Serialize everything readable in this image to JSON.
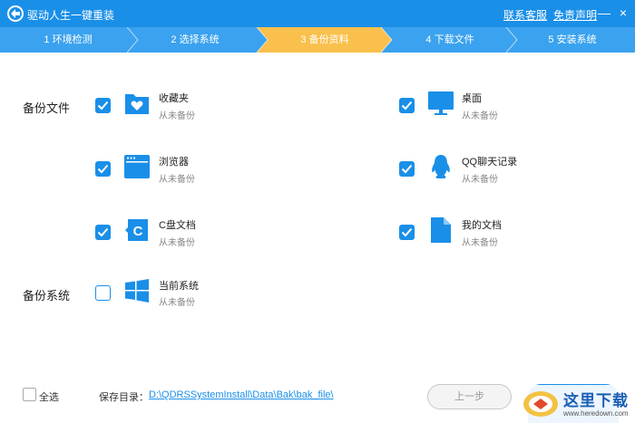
{
  "window": {
    "title": "驱动人生一键重装",
    "links": {
      "contact": "联系客服",
      "disclaimer": "免责声明"
    },
    "controls": {
      "minimize": "—",
      "close": "×"
    }
  },
  "steps": [
    {
      "label": "1 环境检测",
      "active": false
    },
    {
      "label": "2 选择系统",
      "active": false
    },
    {
      "label": "3 备份资料",
      "active": true
    },
    {
      "label": "4 下载文件",
      "active": false
    },
    {
      "label": "5 安装系统",
      "active": false
    }
  ],
  "colors": {
    "accent": "#1a8fe8",
    "step_bar": "#3aa2ef",
    "step_active": "#f9c04c",
    "muted": "#888888"
  },
  "backup_files": {
    "label": "备份文件",
    "items": [
      {
        "name": "收藏夹",
        "status": "从未备份",
        "checked": true,
        "icon": "heart-folder-icon"
      },
      {
        "name": "桌面",
        "status": "从未备份",
        "checked": true,
        "icon": "monitor-icon"
      },
      {
        "name": "浏览器",
        "status": "从未备份",
        "checked": true,
        "icon": "browser-window-icon"
      },
      {
        "name": "QQ聊天记录",
        "status": "从未备份",
        "checked": true,
        "icon": "qq-penguin-icon"
      },
      {
        "name": "C盘文档",
        "status": "从未备份",
        "checked": true,
        "icon": "c-drive-icon"
      },
      {
        "name": "我的文档",
        "status": "从未备份",
        "checked": true,
        "icon": "document-icon"
      }
    ]
  },
  "backup_system": {
    "label": "备份系统",
    "items": [
      {
        "name": "当前系统",
        "status": "从未备份",
        "checked": false,
        "icon": "windows-logo-icon"
      }
    ]
  },
  "footer": {
    "select_all": "全选",
    "save_dir_label": "保存目录：",
    "save_dir_path": "D:\\QDRSSystemInstall\\Data\\Bak\\bak_file\\",
    "prev_button": "上一步"
  },
  "watermark": {
    "text": "这里下载",
    "url": "www.heredown.com"
  }
}
